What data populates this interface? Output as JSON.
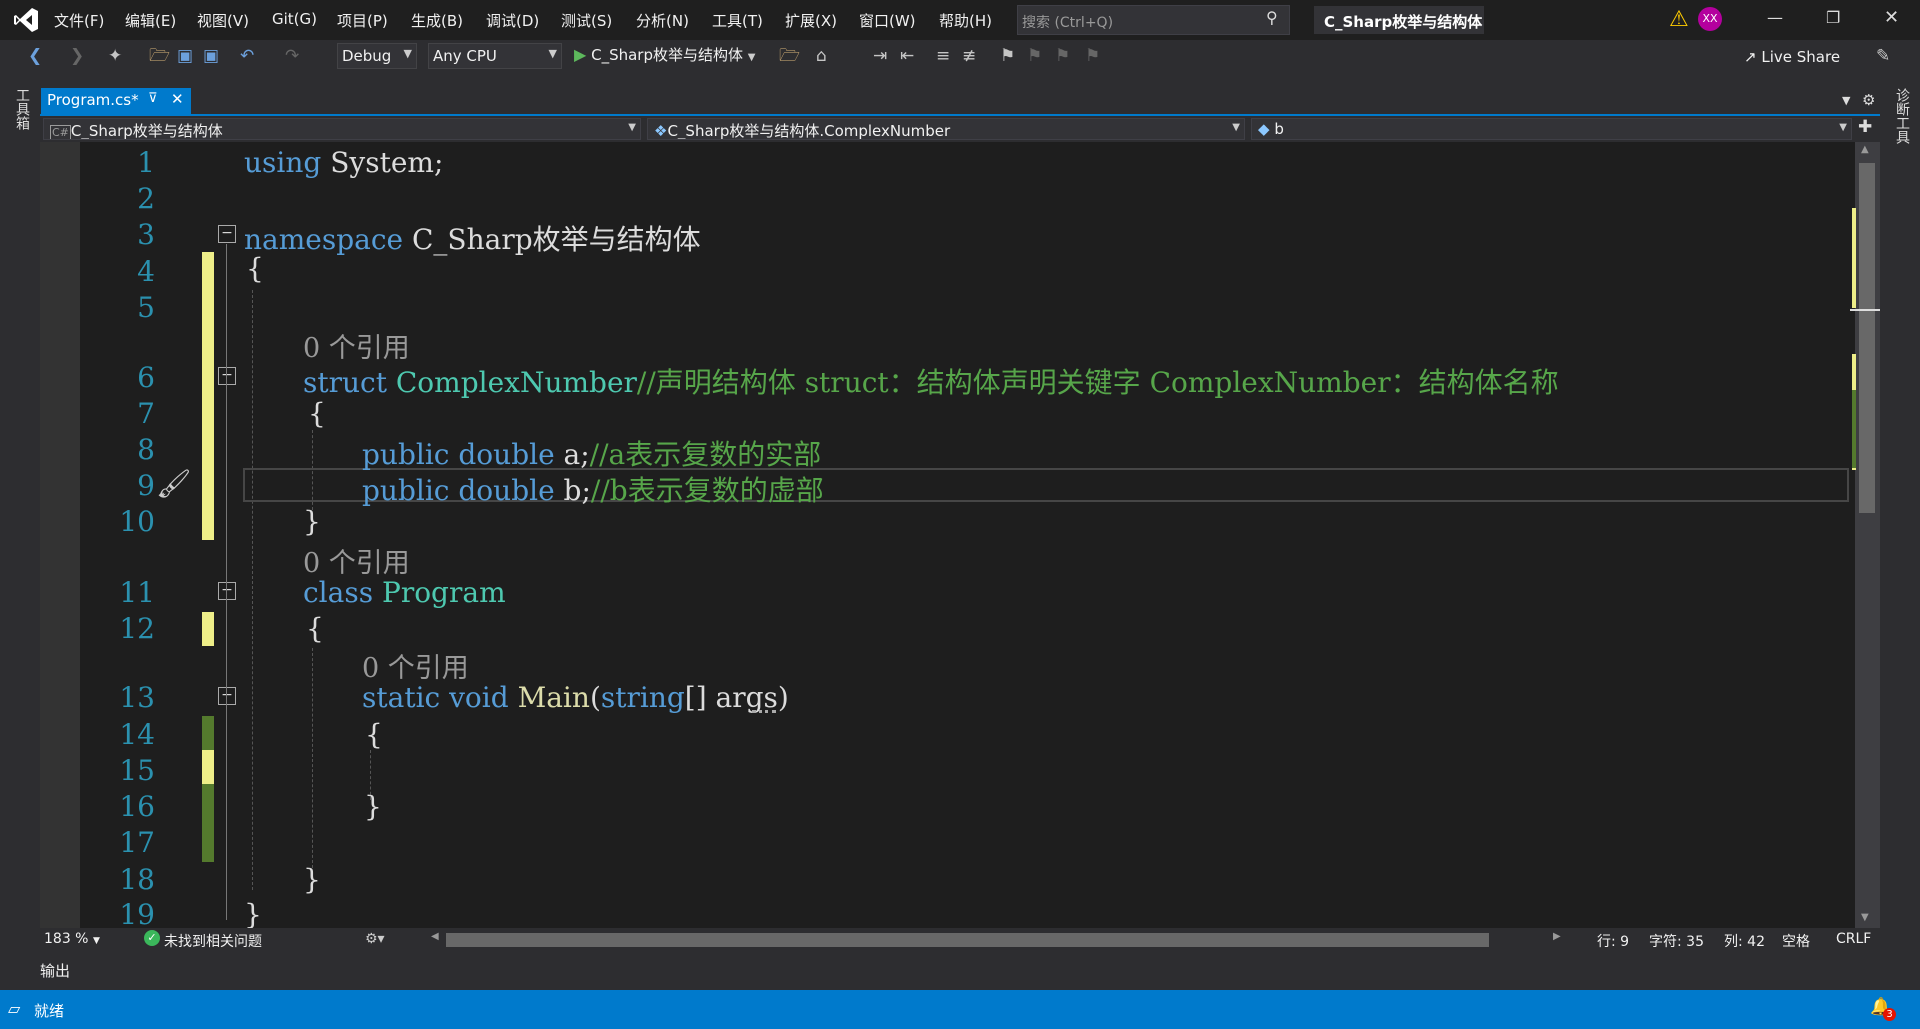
{
  "menu": {
    "items": [
      "文件(F)",
      "编辑(E)",
      "视图(V)",
      "Git(G)",
      "项目(P)",
      "生成(B)",
      "调试(D)",
      "测试(S)",
      "分析(N)",
      "工具(T)",
      "扩展(X)",
      "窗口(W)",
      "帮助(H)"
    ]
  },
  "search": {
    "placeholder": "搜索 (Ctrl+Q)"
  },
  "solution_title": "C_Sharp枚举与结构体",
  "avatar": "XX",
  "toolbar": {
    "config": "Debug",
    "platform": "Any CPU",
    "start_target": "C_Sharp枚举与结构体",
    "live_share": "Live Share"
  },
  "left_panel": "工具箱",
  "right_panel": "诊断工具",
  "tab": {
    "label": "Program.cs*"
  },
  "nav": {
    "project": "C_Sharp枚举与结构体",
    "type": "C_Sharp枚举与结构体.ComplexNumber",
    "member": "b"
  },
  "code": {
    "l1_kw": "using",
    "l1_rest": " System;",
    "l3_kw": "namespace",
    "l3_rest": " C_Sharp枚举与结构体",
    "l4": "{",
    "lens1": "0 个引用",
    "l6_kw": "struct",
    "l6_ty": " ComplexNumber",
    "l6_cm": "//声明结构体 struct：结构体声明关键字 ComplexNumber：结构体名称",
    "l7": "{",
    "l8_kw": "public double",
    "l8_rest": " a;",
    "l8_cm": "//a表示复数的实部",
    "l9_kw": "public double",
    "l9_rest": " b;",
    "l9_cm": "//b表示复数的虚部",
    "l10": "}",
    "lens2": "0 个引用",
    "l11_kw": "class",
    "l11_ty": " Program",
    "l12": "{",
    "lens3": "0 个引用",
    "l13_kw": "static void",
    "l13_fn": " Main",
    "l13_p1": "(",
    "l13_kw2": "string",
    "l13_p2": "[] args)",
    "l14": "{",
    "l16": "}",
    "l18": "}",
    "l19": "}"
  },
  "line_numbers": [
    "1",
    "2",
    "3",
    "4",
    "5",
    "6",
    "7",
    "8",
    "9",
    "10",
    "11",
    "12",
    "13",
    "14",
    "15",
    "16",
    "17",
    "18",
    "19"
  ],
  "status": {
    "zoom": "183 %",
    "issues": "未找到相关问题",
    "line": "行: 9",
    "char": "字符: 35",
    "col": "列: 42",
    "spacing": "空格",
    "eol": "CRLF"
  },
  "output_label": "输出",
  "ready": "就绪",
  "notification_count": "3",
  "colors": {
    "accent": "#007acc",
    "keyword": "#569cd6",
    "type": "#4ec9b0",
    "comment": "#57a64a",
    "line_number": "#2b91af"
  }
}
